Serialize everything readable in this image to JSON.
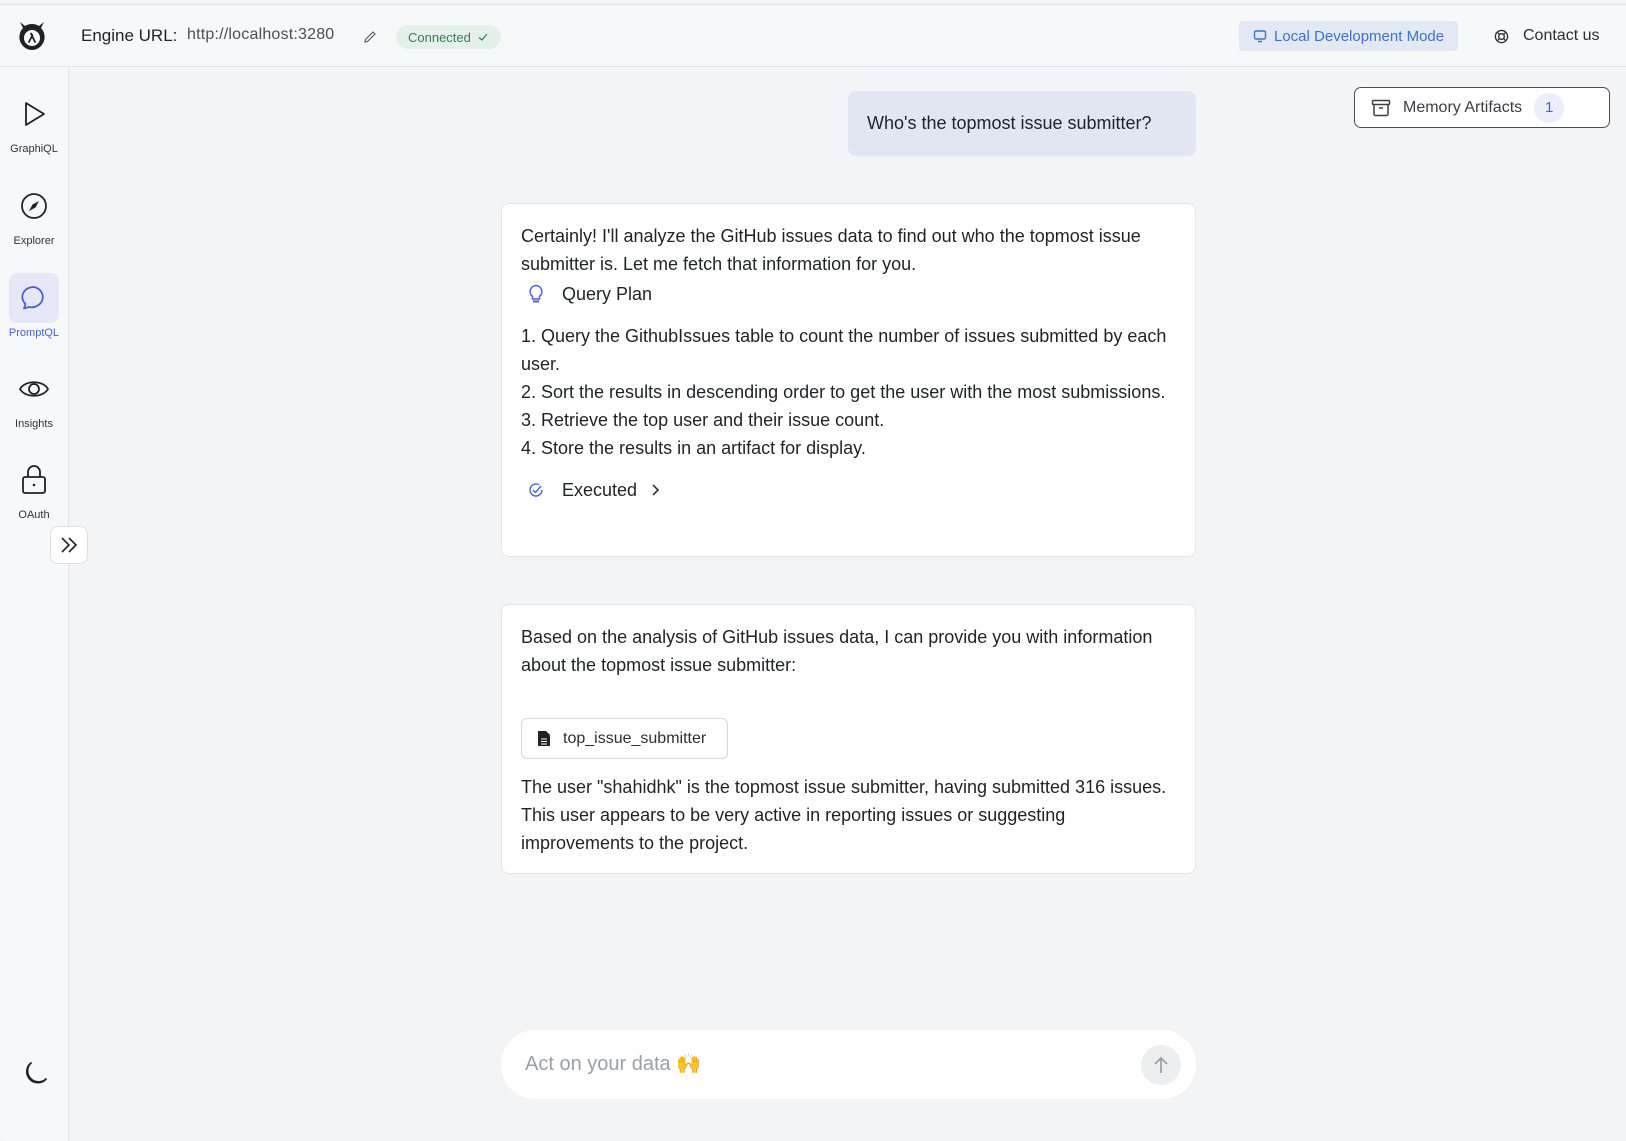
{
  "header": {
    "engine_label": "Engine URL:",
    "engine_url": "http://localhost:3280",
    "connection_status": "Connected",
    "mode_label": "Local Development Mode",
    "contact_label": "Contact us"
  },
  "sidebar": {
    "items": [
      {
        "label": "GraphiQL",
        "icon": "play-icon",
        "active": false
      },
      {
        "label": "Explorer",
        "icon": "compass-icon",
        "active": false
      },
      {
        "label": "PromptQL",
        "icon": "chat-bubble-icon",
        "active": true
      },
      {
        "label": "Insights",
        "icon": "eye-icon",
        "active": false
      },
      {
        "label": "OAuth",
        "icon": "lock-icon",
        "active": false
      }
    ]
  },
  "memory_artifacts": {
    "label": "Memory Artifacts",
    "count": "1"
  },
  "conversation": {
    "user_message": "Who's the topmost issue submitter?",
    "assistant_1": {
      "intro": "Certainly! I'll analyze the GitHub issues data to find out who the topmost issue submitter is. Let me fetch that information for you.",
      "query_plan_label": "Query Plan",
      "plan_steps": [
        "1. Query the GithubIssues table to count the number of issues submitted by each user.",
        "2. Sort the results in descending order to get the user with the most submissions.",
        "3. Retrieve the top user and their issue count.",
        "4. Store the results in an artifact for display."
      ],
      "status_label": "Executed"
    },
    "assistant_2": {
      "intro": "Based on the analysis of GitHub issues data, I can provide you with information about the topmost issue submitter:",
      "artifact_name": "top_issue_submitter",
      "result": "The user \"shahidhk\" is the topmost issue submitter, having submitted 316 issues. This user appears to be very active in reporting issues or suggesting improvements to the project."
    }
  },
  "composer": {
    "placeholder": "Act on your data 🙌",
    "value": ""
  },
  "colors": {
    "accent": "#4b5fd6",
    "connected": "#3d7a55",
    "local_mode": "#3f73c5",
    "user_bubble": "#e2e6f3"
  }
}
